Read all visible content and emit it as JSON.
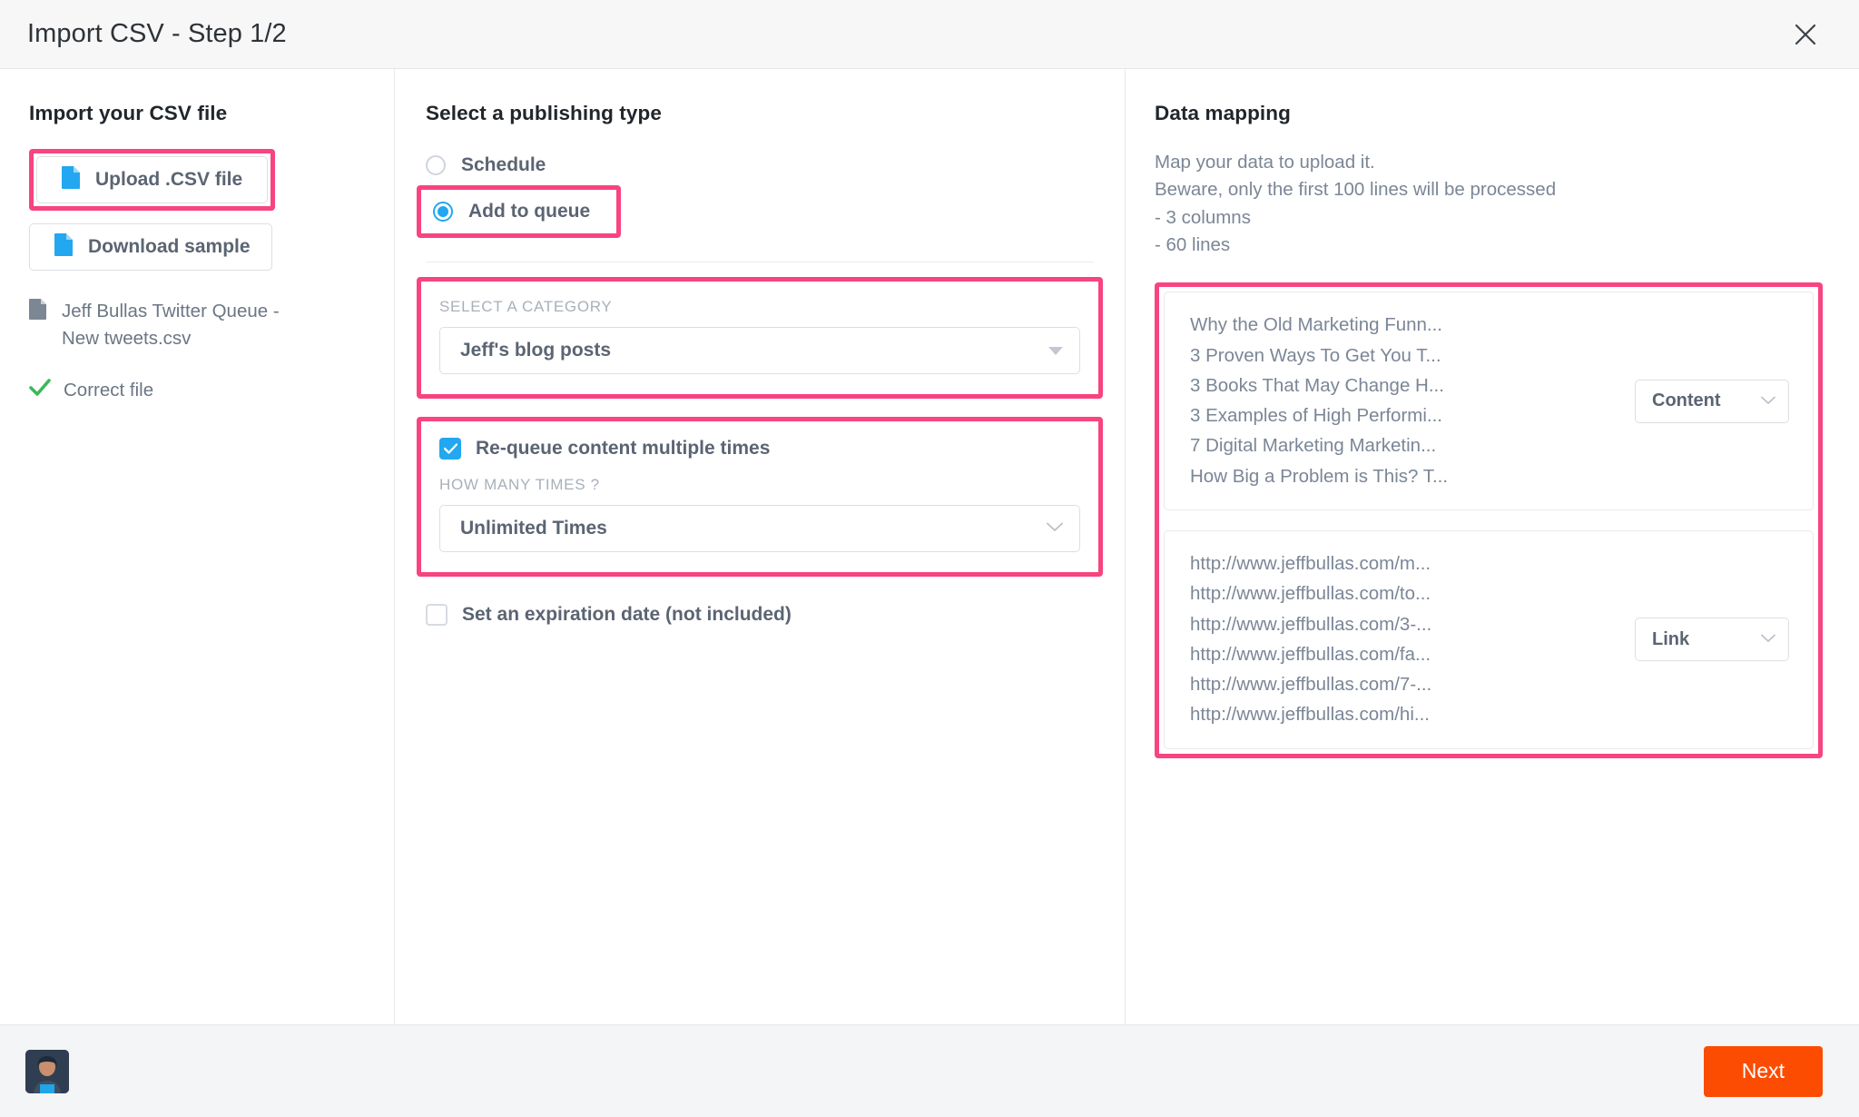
{
  "window": {
    "title": "Import CSV - Step 1/2",
    "close_icon": "close-icon"
  },
  "left_panel": {
    "heading": "Import your CSV file",
    "upload_button": "Upload .CSV file",
    "download_button": "Download sample",
    "filename": "Jeff Bullas Twitter Queue - New tweets.csv",
    "status": "Correct file"
  },
  "middle_panel": {
    "heading": "Select a publishing type",
    "radios": [
      {
        "label": "Schedule",
        "selected": false
      },
      {
        "label": "Add to queue",
        "selected": true
      }
    ],
    "category": {
      "label": "SELECT A CATEGORY",
      "value": "Jeff's blog posts"
    },
    "requeue": {
      "label": "Re-queue content multiple times",
      "checked": true,
      "times_label": "HOW MANY TIMES ?",
      "times_value": "Unlimited Times"
    },
    "expiration": {
      "label": "Set an expiration date (not included)",
      "checked": false
    }
  },
  "right_panel": {
    "heading": "Data mapping",
    "description_lines": [
      "Map your data to upload it.",
      "Beware, only the first 100 lines will be processed",
      "- 3 columns",
      "- 60 lines"
    ],
    "groups": [
      {
        "mapping_value": "Content",
        "items": [
          "Why the Old Marketing Funn...",
          "3 Proven Ways To Get You T...",
          "3 Books That May Change H...",
          "3 Examples of High Performi...",
          "7 Digital Marketing Marketin...",
          "How Big a Problem is This? T..."
        ]
      },
      {
        "mapping_value": "Link",
        "items": [
          "http://www.jeffbullas.com/m...",
          "http://www.jeffbullas.com/to...",
          "http://www.jeffbullas.com/3-...",
          "http://www.jeffbullas.com/fa...",
          "http://www.jeffbullas.com/7-...",
          "http://www.jeffbullas.com/hi..."
        ]
      }
    ]
  },
  "footer": {
    "avatar": "user-avatar",
    "next_button": "Next"
  },
  "colors": {
    "highlight": "#f8447f",
    "accent_blue": "#22a7f0",
    "next_orange": "#fc4c02",
    "success_green": "#3cb85b"
  }
}
